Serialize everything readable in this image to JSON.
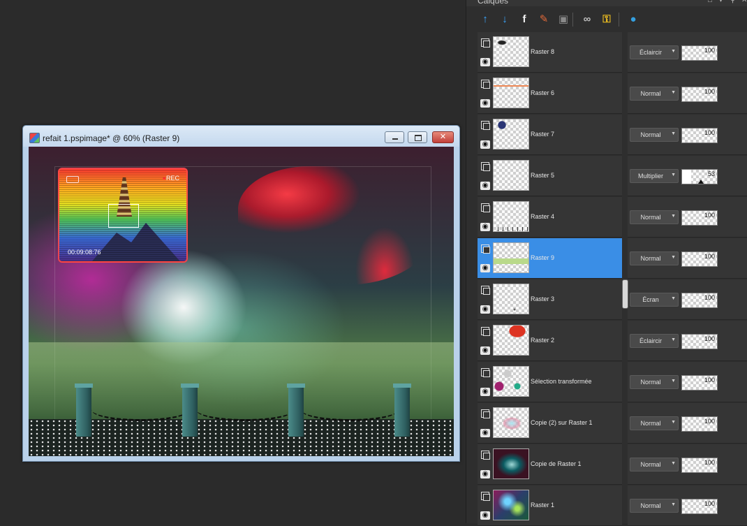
{
  "document": {
    "title": "refait 1.pspimage* @  60% (Raster 9)"
  },
  "canvas": {
    "rec_label": "REC",
    "rec_time": "00:09:08:76"
  },
  "panel": {
    "title": "Calques",
    "toolbar": [
      {
        "name": "new-raster-layer",
        "icon": "layer-up-arrow-icon",
        "glyph": "↑",
        "color": "#3aa7ff"
      },
      {
        "name": "new-vector-layer",
        "icon": "layer-down-arrow-icon",
        "glyph": "↓",
        "color": "#3aa7ff"
      },
      {
        "name": "layer-effects",
        "icon": "fx-icon",
        "glyph": "f",
        "color": "#f0f0f0"
      },
      {
        "name": "adjustment-layer",
        "icon": "brush-icon",
        "glyph": "✎",
        "color": "#e26a3a"
      },
      {
        "name": "mask-layer",
        "icon": "mask-icon",
        "glyph": "▣",
        "color": "#8a8a8a"
      },
      {
        "name": "link-layers",
        "icon": "link-icon",
        "glyph": "∞",
        "color": "#bfbfbf"
      },
      {
        "name": "lock-transparency",
        "icon": "lock-icon",
        "glyph": "⚿",
        "color": "#f0c020"
      },
      {
        "name": "layer-properties",
        "icon": "palette-icon",
        "glyph": "●",
        "color": "#35a0e0"
      }
    ],
    "layers": [
      {
        "name": "Raster 8",
        "blend": "Éclaircir",
        "opacity": "100",
        "opacity_level": 100,
        "selected": false,
        "thumb": "spot"
      },
      {
        "name": "Raster 6",
        "blend": "Normal",
        "opacity": "100",
        "opacity_level": 100,
        "selected": false,
        "thumb": "redline"
      },
      {
        "name": "Raster 7",
        "blend": "Normal",
        "opacity": "100",
        "opacity_level": 100,
        "selected": false,
        "thumb": "pagoda"
      },
      {
        "name": "Raster 5",
        "blend": "Multiplier",
        "opacity": "53",
        "opacity_level": 53,
        "selected": false,
        "thumb": "empty"
      },
      {
        "name": "Raster 4",
        "blend": "Normal",
        "opacity": "100",
        "opacity_level": 100,
        "selected": false,
        "thumb": "fence"
      },
      {
        "name": "Raster 9",
        "blend": "Normal",
        "opacity": "100",
        "opacity_level": 100,
        "selected": true,
        "thumb": "grass"
      },
      {
        "name": "Raster 3",
        "blend": "Écran",
        "opacity": "100",
        "opacity_level": 100,
        "selected": false,
        "thumb": "dots"
      },
      {
        "name": "Raster 2",
        "blend": "Éclaircir",
        "opacity": "100",
        "opacity_level": 100,
        "selected": false,
        "thumb": "redcorner"
      },
      {
        "name": "Sélection transformée",
        "blend": "Normal",
        "opacity": "100",
        "opacity_level": 100,
        "selected": false,
        "thumb": "colors"
      },
      {
        "name": "Copie (2) sur Raster 1",
        "blend": "Normal",
        "opacity": "100",
        "opacity_level": 100,
        "selected": false,
        "thumb": "glow"
      },
      {
        "name": "Copie de Raster 1",
        "blend": "Normal",
        "opacity": "100",
        "opacity_level": 100,
        "selected": false,
        "thumb": "teal"
      },
      {
        "name": "Raster 1",
        "blend": "Normal",
        "opacity": "100",
        "opacity_level": 100,
        "selected": false,
        "thumb": "rainbow"
      }
    ]
  }
}
